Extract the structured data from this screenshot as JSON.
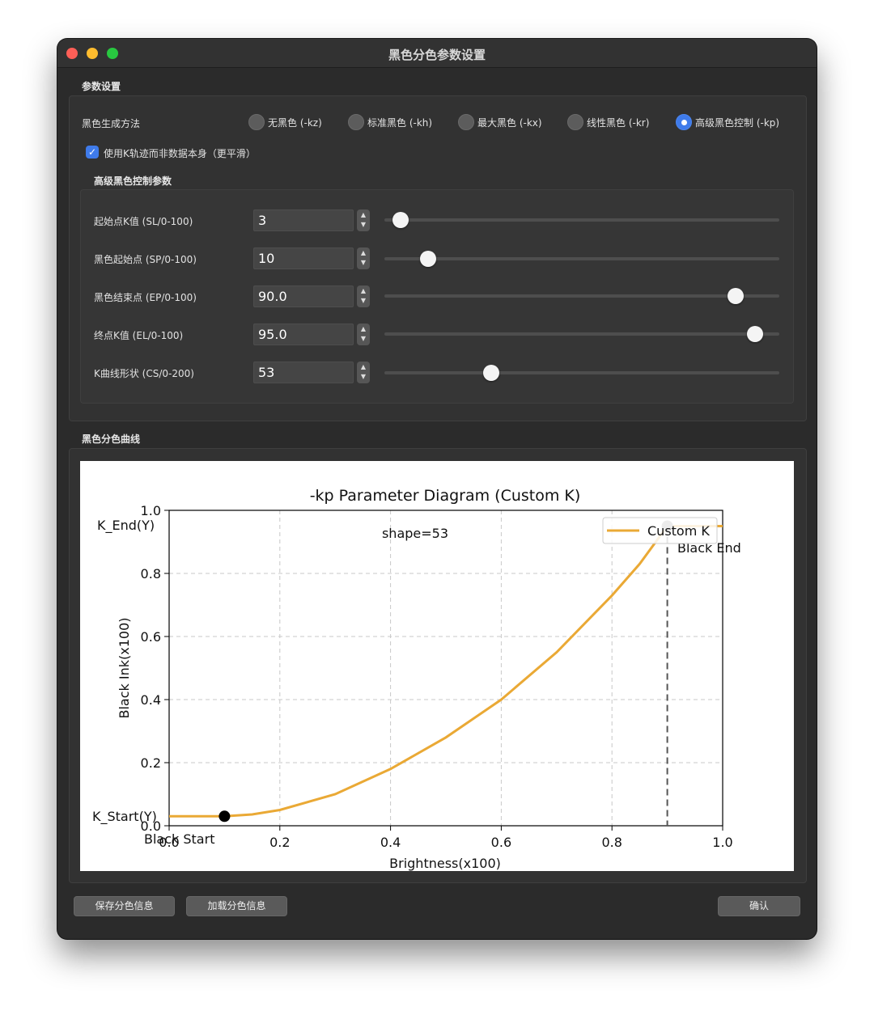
{
  "window": {
    "title": "黑色分色参数设置"
  },
  "params_group": {
    "title": "参数设置",
    "method_label": "黑色生成方法",
    "methods": [
      {
        "label": "无黑色 (-kz)",
        "checked": false
      },
      {
        "label": "标准黑色 (-kh)",
        "checked": false
      },
      {
        "label": "最大黑色 (-kx)",
        "checked": false
      },
      {
        "label": "线性黑色 (-kr)",
        "checked": false
      },
      {
        "label": "高级黑色控制 (-kp)",
        "checked": true
      }
    ],
    "use_k_locus": {
      "label": "使用K轨迹而非数据本身（更平滑）",
      "checked": true
    },
    "advanced": {
      "title": "高级黑色控制参数",
      "rows": [
        {
          "label": "起始点K值 (SL/0-100)",
          "value": "3",
          "slider_percent": 3
        },
        {
          "label": "黑色起始点 (SP/0-100)",
          "value": "10",
          "slider_percent": 10
        },
        {
          "label": "黑色结束点 (EP/0-100)",
          "value": "90.0",
          "slider_percent": 90
        },
        {
          "label": "终点K值 (EL/0-100)",
          "value": "95.0",
          "slider_percent": 95
        },
        {
          "label": "K曲线形状 (CS/0-200)",
          "value": "53",
          "slider_percent": 26.5
        }
      ]
    }
  },
  "curve_group": {
    "title": "黑色分色曲线"
  },
  "chart_data": {
    "type": "line",
    "title": "-kp Parameter Diagram (Custom K)",
    "xlabel": "Brightness(x100)",
    "ylabel": "Black Ink(x100)",
    "xlim": [
      0,
      1
    ],
    "ylim": [
      0,
      1
    ],
    "xticks": [
      "0.0",
      "0.2",
      "0.4",
      "0.6",
      "0.8",
      "1.0"
    ],
    "yticks": [
      "0.0",
      "0.2",
      "0.4",
      "0.6",
      "0.8",
      "1.0"
    ],
    "grid": true,
    "legend_position": "top-right",
    "series": [
      {
        "name": "Custom K",
        "color": "#eaa935",
        "x": [
          0.0,
          0.1,
          0.15,
          0.2,
          0.3,
          0.4,
          0.5,
          0.6,
          0.7,
          0.8,
          0.85,
          0.9,
          1.0
        ],
        "y": [
          0.03,
          0.03,
          0.036,
          0.05,
          0.1,
          0.18,
          0.28,
          0.4,
          0.55,
          0.73,
          0.83,
          0.95,
          0.95
        ]
      }
    ],
    "markers": [
      {
        "x": 0.1,
        "y": 0.03
      },
      {
        "x": 0.9,
        "y": 0.95
      }
    ],
    "vline_x": 0.9,
    "annotations": {
      "shape": "shape=53",
      "k_end": "K_End(Y)",
      "k_start": "K_Start(Y)",
      "black_start": "Black Start",
      "black_end": "Black End"
    }
  },
  "buttons": {
    "save": "保存分色信息",
    "load": "加载分色信息",
    "confirm": "确认"
  }
}
